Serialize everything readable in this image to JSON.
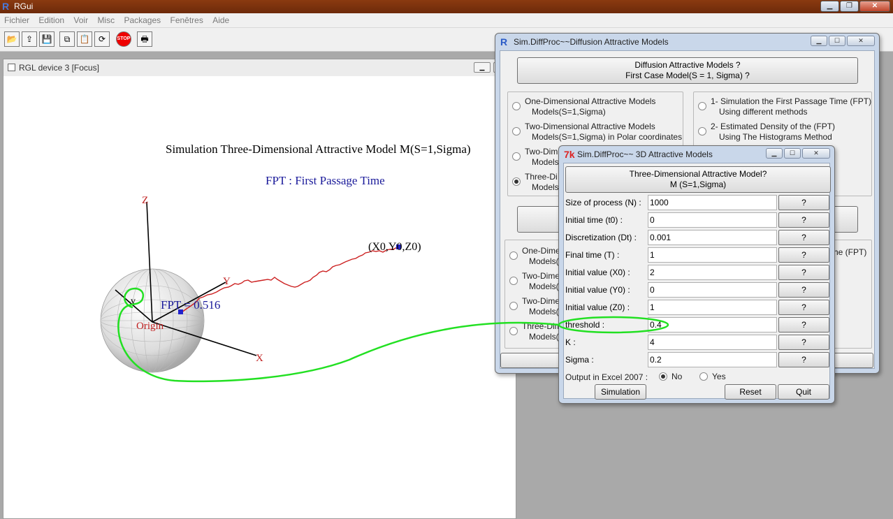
{
  "app": {
    "title": "RGui"
  },
  "menu": [
    "Fichier",
    "Edition",
    "Voir",
    "Misc",
    "Packages",
    "Fenêtres",
    "Aide"
  ],
  "toolbar": {
    "icons": [
      "open-icon",
      "load-workspace-icon",
      "save-icon",
      "copy-icon",
      "paste-icon",
      "refresh-icon",
      "stop-icon",
      "print-icon"
    ],
    "stop_label": "STOP"
  },
  "rgl": {
    "title": "RGL device 3 [Focus]",
    "plot_title": "Simulation Three-Dimensional Attractive Model M(S=1,Sigma)",
    "subtitle": "FPT : First Passage Time",
    "axes": {
      "x": "X",
      "y": "Y",
      "z": "Z"
    },
    "labels": {
      "v": "v",
      "origin": "Origin",
      "fpt": "FPT = 0.516",
      "start": "(X0,Y0,Z0)"
    }
  },
  "main_dialog": {
    "title": "Sim.DiffProc~~Diffusion Attractive Models",
    "header_line1": "Diffusion Attractive Models ?",
    "header_line2": "First Case Model(S = 1, Sigma) ?",
    "left_group": [
      {
        "l1": "One-Dimensional Attractive Models",
        "l2": "Models(S=1,Sigma)",
        "selected": false
      },
      {
        "l1": "Two-Dimensional Attractive Models",
        "l2": "Models(S=1,Sigma) in Polar coordinates",
        "selected": false
      },
      {
        "l1": "Two-Dim",
        "l2": "Models",
        "selected": false
      },
      {
        "l1": "Three-Di",
        "l2": "Models",
        "selected": true
      }
    ],
    "right_group": [
      {
        "l1": "1- Simulation the First Passage Time (FPT)",
        "l2": "Using different methods"
      },
      {
        "l1": "2- Estimated Density of the (FPT)",
        "l2": "Using The Histograms Method"
      }
    ],
    "lower_group": [
      {
        "l1": "One-Dime",
        "l2": "Models("
      },
      {
        "l1": "Two-Dime",
        "l2": "Models("
      },
      {
        "l1": "Two-Dime",
        "l2": "Models("
      },
      {
        "l1": "Three-Dim",
        "l2": "Models("
      }
    ],
    "lower_right_fragment": "he (FPT)"
  },
  "sub_dialog": {
    "title": "Sim.DiffProc~~ 3D Attractive Models",
    "header_line1": "Three-Dimensional Attractive Model?",
    "header_line2": "M (S=1,Sigma)",
    "help_label": "?",
    "fields": [
      {
        "label": "Size of process (N) :",
        "value": "1000"
      },
      {
        "label": "Initial time (t0) :",
        "value": "0"
      },
      {
        "label": "Discretization (Dt) :",
        "value": "0.001"
      },
      {
        "label": "Final time (T) :",
        "value": "1"
      },
      {
        "label": "Initial value (X0) :",
        "value": "2"
      },
      {
        "label": "Initial value (Y0) :",
        "value": "0"
      },
      {
        "label": "Initial value (Z0) :",
        "value": "1"
      },
      {
        "label": "threshold :",
        "value": "0.4"
      },
      {
        "label": "K :",
        "value": "4"
      },
      {
        "label": "Sigma :",
        "value": "0.2"
      }
    ],
    "excel_label": "Output in Excel 2007 :",
    "excel_options": [
      "No",
      "Yes"
    ],
    "excel_selected": "No",
    "buttons": {
      "simulation": "Simulation",
      "reset": "Reset",
      "quit": "Quit"
    }
  },
  "colors": {
    "titlebar": "#7a300c",
    "annotation": "#22e022",
    "axis_label": "#c02020",
    "text_blue": "#1a1a9a"
  }
}
